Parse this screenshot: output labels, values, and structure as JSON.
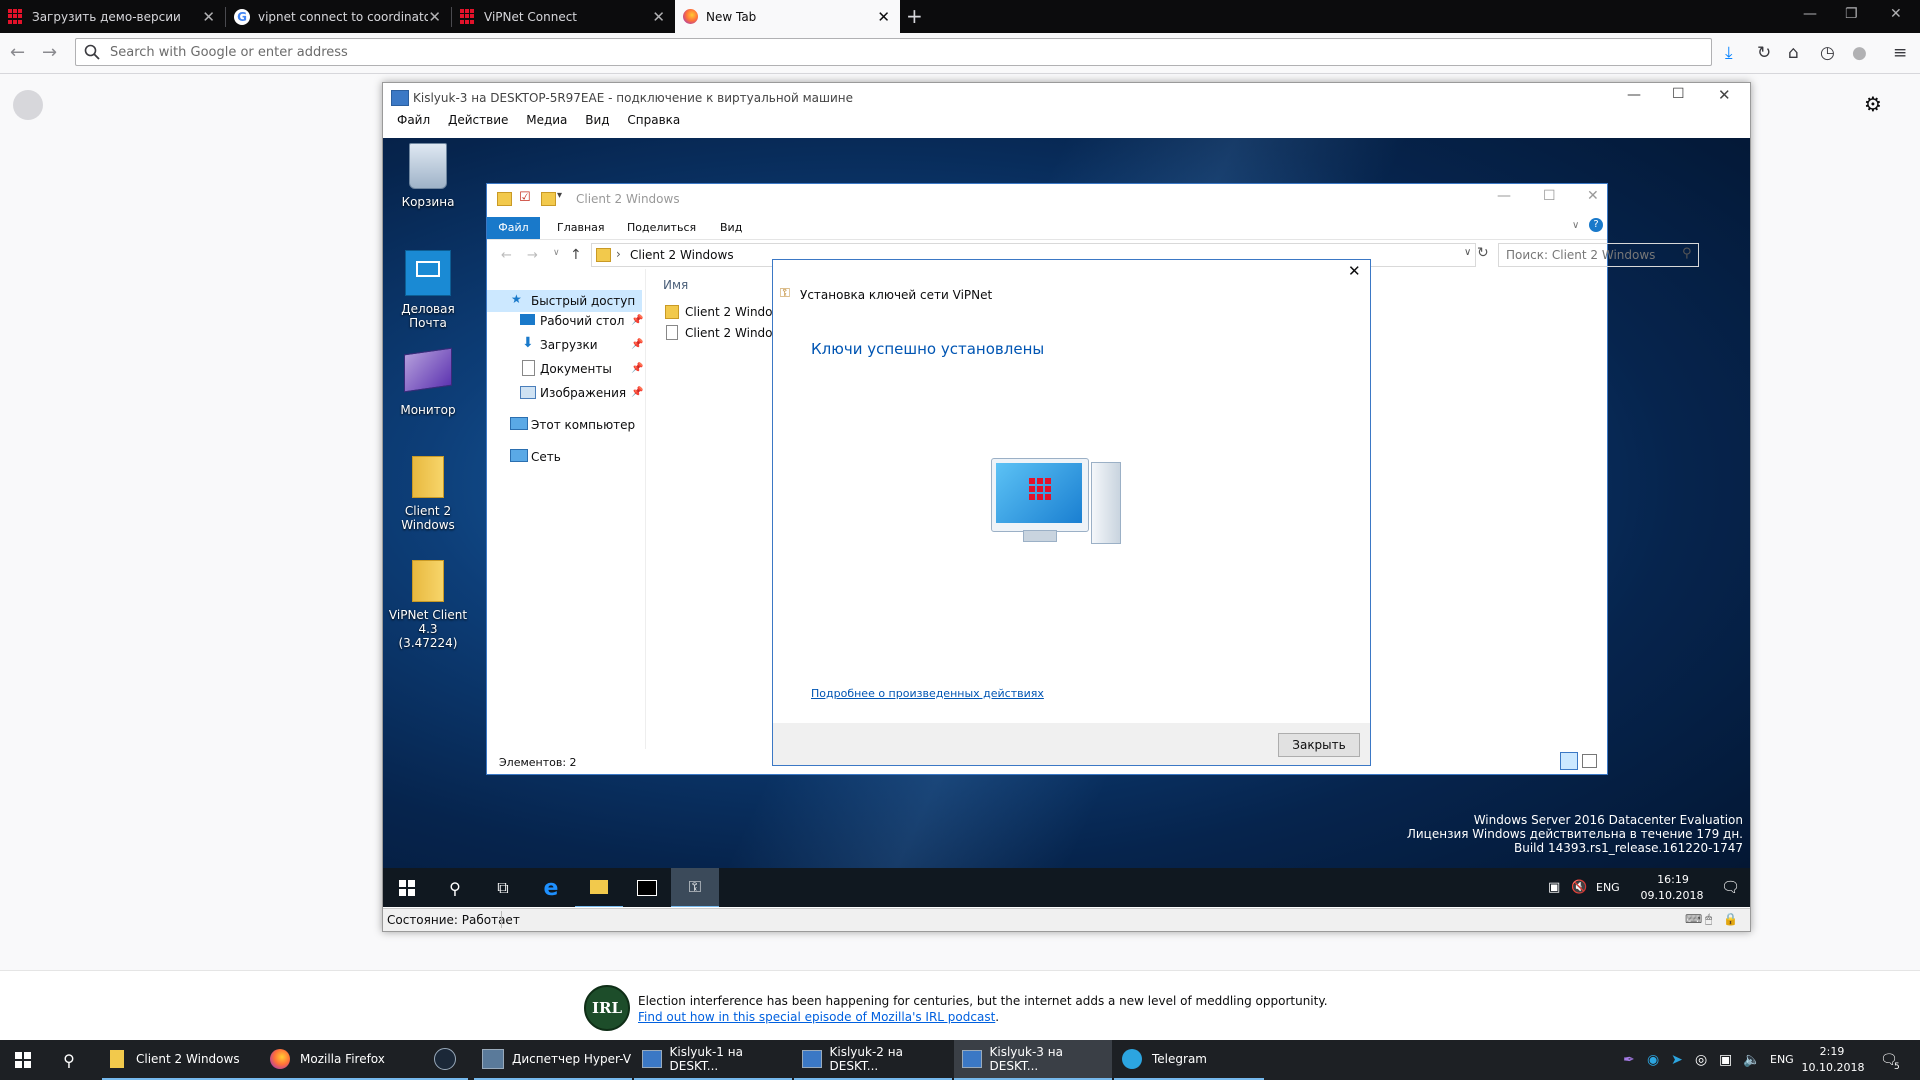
{
  "browser": {
    "tabs": [
      {
        "title": "Загрузить демо-версии",
        "icon": "vipnet-favicon"
      },
      {
        "title": "vipnet connect to coordinator",
        "icon": "google-favicon"
      },
      {
        "title": "ViPNet Connect",
        "icon": "vipnet-favicon"
      },
      {
        "title": "New Tab",
        "icon": "firefox-favicon",
        "active": true
      }
    ],
    "new_tab_symbol": "+",
    "address_placeholder": "Search with Google or enter address"
  },
  "vm_window": {
    "title": "Kislyuk-3 на DESKTOP-5R97EAE - подключение к виртуальной машине",
    "menu": [
      "Файл",
      "Действие",
      "Медиа",
      "Вид",
      "Справка"
    ],
    "status": "Состояние: Работает"
  },
  "desktop_icons": [
    {
      "label": "Корзина",
      "icon": "recycle-bin-icon"
    },
    {
      "label": "Деловая Почта",
      "icon": "business-mail-icon"
    },
    {
      "label": "Монитор",
      "icon": "monitor-app-icon"
    },
    {
      "label": "Client 2 Windows",
      "icon": "folder-icon"
    },
    {
      "label": "ViPNet Client 4.3 (3.47224)",
      "icon": "folder-icon"
    }
  ],
  "explorer": {
    "title": "Client 2 Windows",
    "ribbon_tabs": [
      "Файл",
      "Главная",
      "Поделиться",
      "Вид"
    ],
    "address": "Client 2 Windows",
    "search_placeholder": "Поиск: Client 2 Windows",
    "column_header": "Имя",
    "nav_items": [
      {
        "label": "Быстрый доступ",
        "icon": "star-icon"
      },
      {
        "label": "Рабочий стол",
        "icon": "desktop-icon",
        "pinned": true
      },
      {
        "label": "Загрузки",
        "icon": "download-icon",
        "pinned": true
      },
      {
        "label": "Документы",
        "icon": "documents-icon",
        "pinned": true
      },
      {
        "label": "Изображения",
        "icon": "pictures-icon",
        "pinned": true
      },
      {
        "label": "Этот компьютер",
        "icon": "computer-icon"
      },
      {
        "label": "Сеть",
        "icon": "network-icon"
      }
    ],
    "files": [
      {
        "name": "Client 2 Windo",
        "icon": "folder-icon"
      },
      {
        "name": "Client 2 Windo",
        "icon": "file-icon"
      }
    ],
    "status": "Элементов: 2"
  },
  "dialog": {
    "title": "Установка ключей сети ViPNet",
    "heading": "Ключи успешно установлены",
    "details_link": "Подробнее о произведенных действиях",
    "close_button": "Закрыть"
  },
  "guest_watermark": {
    "line1": "Windows Server 2016 Datacenter Evaluation",
    "line2": "Лицензия Windows действительна в течение 179 дн.",
    "line3": "Build 14393.rs1_release.161220-1747"
  },
  "guest_taskbar": {
    "lang": "ENG",
    "time": "16:19",
    "date": "09.10.2018"
  },
  "snippet": {
    "badge": "IRL",
    "text": "Election interference has been happening for centuries, but the internet adds a new level of meddling opportunity.",
    "link": "Find out how in this special episode of Mozilla's IRL podcast",
    "end": "."
  },
  "host_taskbar": {
    "apps": [
      {
        "label": "Client 2 Windows",
        "icon": "folder-icon"
      },
      {
        "label": "Mozilla Firefox",
        "icon": "firefox-icon"
      },
      {
        "label": "",
        "icon": "steam-icon"
      },
      {
        "label": "Диспетчер Hyper-V",
        "icon": "hyperv-icon"
      },
      {
        "label": "Kislyuk-1 на DESKT...",
        "icon": "vmconnect-icon"
      },
      {
        "label": "Kislyuk-2 на DESKT...",
        "icon": "vmconnect-icon"
      },
      {
        "label": "Kislyuk-3 на DESKT...",
        "icon": "vmconnect-icon"
      },
      {
        "label": "Telegram",
        "icon": "telegram-icon"
      }
    ],
    "lang": "ENG",
    "time": "2:19",
    "date": "10.10.2018",
    "notif_count": "5"
  },
  "colors": {
    "accent": "#0a84ff",
    "dialog_heading": "#0055b3",
    "explorer_file_tab": "#1979ca"
  }
}
